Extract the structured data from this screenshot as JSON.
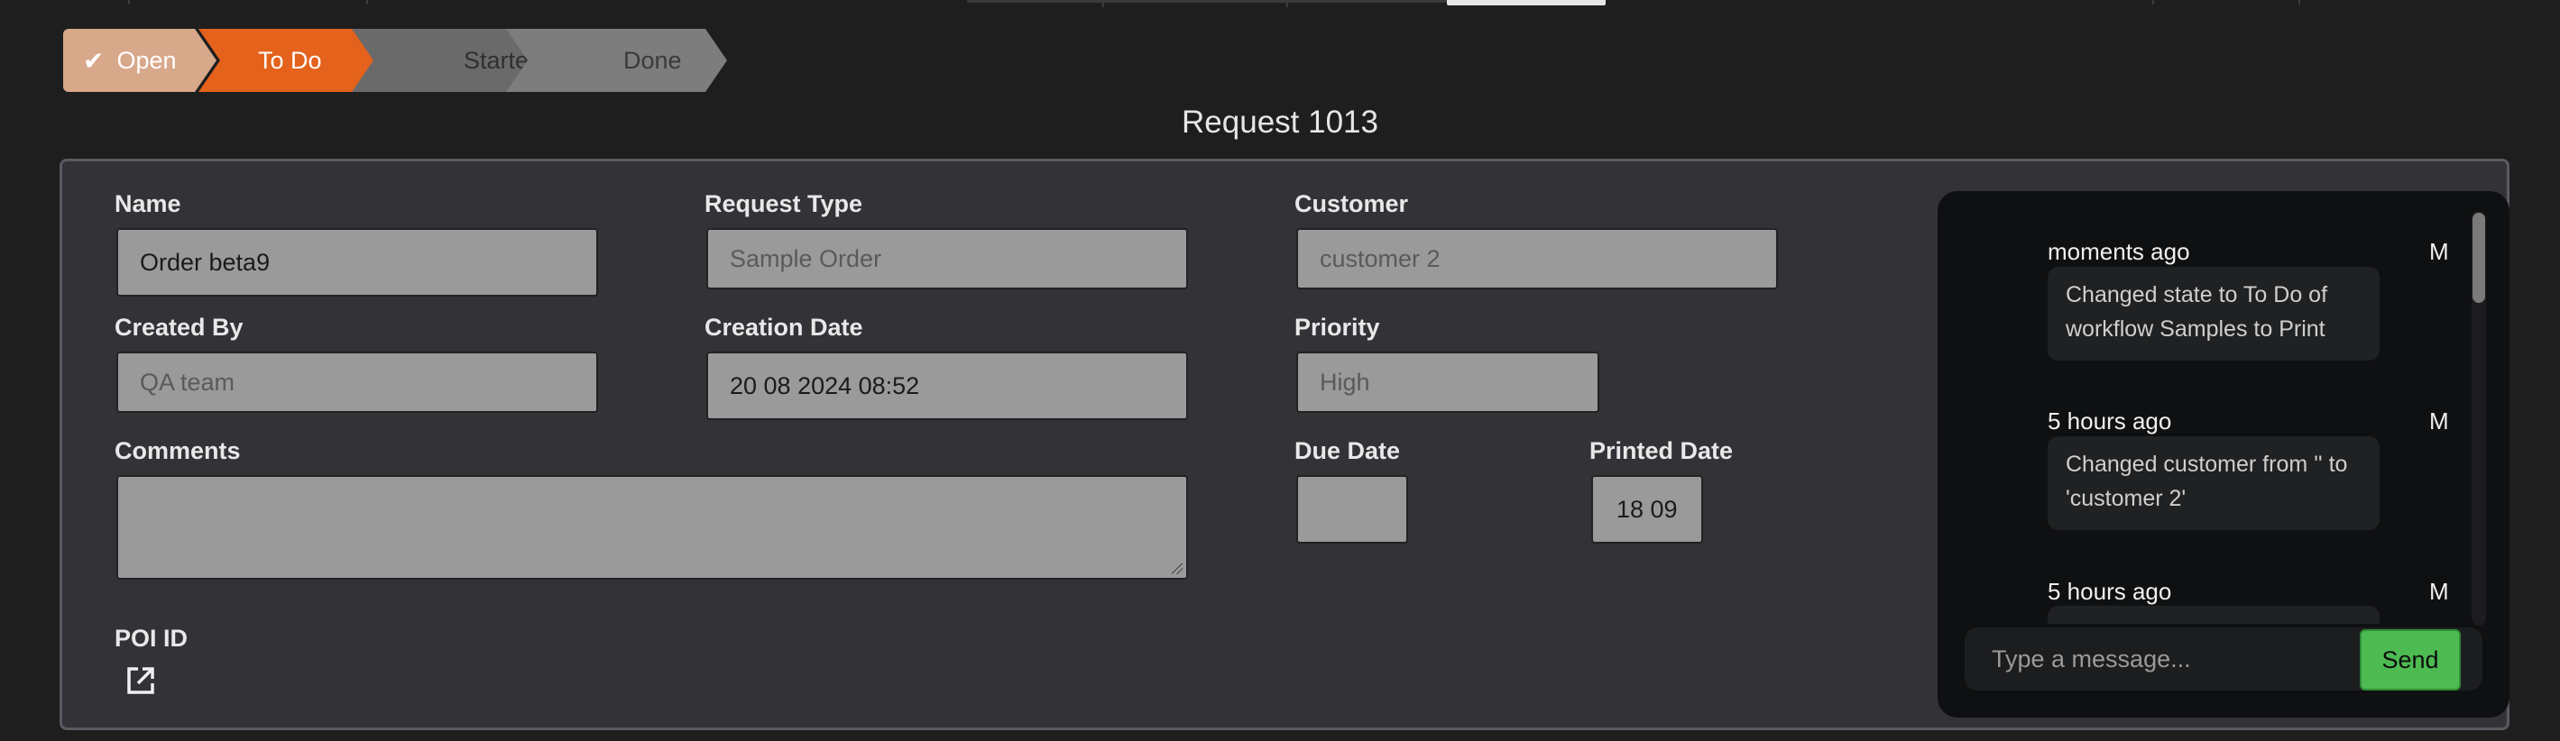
{
  "stages": [
    {
      "label": "Open",
      "state": "completed",
      "color": "#d8a88a"
    },
    {
      "label": "To Do",
      "state": "current",
      "color": "#e4621c"
    },
    {
      "label": "Started",
      "state": "pending",
      "color": "#6a6a6a"
    },
    {
      "label": "Done",
      "state": "pending",
      "color": "#7d7d7d"
    }
  ],
  "title": "Request 1013",
  "form": {
    "name": {
      "label": "Name",
      "value": "Order beta9"
    },
    "request_type": {
      "label": "Request Type",
      "value": "Sample Order"
    },
    "customer": {
      "label": "Customer",
      "value": "customer 2"
    },
    "created_by": {
      "label": "Created By",
      "value": "QA team"
    },
    "creation_date": {
      "label": "Creation Date",
      "value": "20 08 2024 08:52"
    },
    "priority": {
      "label": "Priority",
      "value": "High"
    },
    "comments": {
      "label": "Comments",
      "value": ""
    },
    "due_date": {
      "label": "Due Date",
      "value": ""
    },
    "printed_date": {
      "label": "Printed Date",
      "value": "18 09"
    },
    "poi_id": {
      "label": "POI ID",
      "icon": "external-link-icon"
    }
  },
  "chat": {
    "messages": [
      {
        "time": "moments ago",
        "user": "M",
        "text": "Changed state to To Do of workflow Samples to Print"
      },
      {
        "time": "5 hours ago",
        "user": "M",
        "text": "Changed customer from '' to 'customer 2'"
      },
      {
        "time": "5 hours ago",
        "user": "M",
        "text": ""
      }
    ],
    "input_placeholder": "Type a message...",
    "send_label": "Send"
  },
  "colors": {
    "background": "#1e1e1f",
    "panel": "#323237",
    "field": "#9a9a9a",
    "send": "#4dbb52"
  }
}
